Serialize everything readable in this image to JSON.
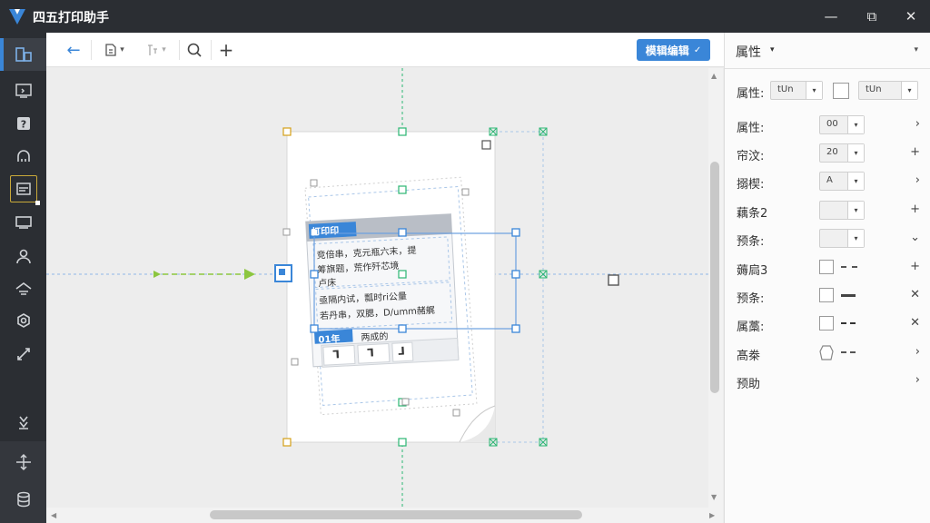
{
  "window": {
    "title": "四五打印助手",
    "buttons": {
      "minimize": "—",
      "restore": "⧉",
      "close": "✕"
    }
  },
  "sidebar": {
    "items": [
      {
        "icon": "layout-icon",
        "active": true
      },
      {
        "icon": "screen-export-icon"
      },
      {
        "icon": "help-icon"
      },
      {
        "icon": "cloud-icon"
      },
      {
        "icon": "image-frame-icon",
        "boxed": true
      },
      {
        "icon": "monitor-icon"
      },
      {
        "icon": "user-icon"
      },
      {
        "icon": "tray-icon"
      },
      {
        "icon": "settings-icon"
      },
      {
        "icon": "tools-icon"
      },
      {
        "icon": "arrows-down-icon"
      },
      {
        "icon": "move-icon"
      },
      {
        "icon": "database-icon"
      }
    ]
  },
  "toolbar": {
    "back": "←",
    "copy_caret": "▾",
    "align_caret": "▾",
    "search": "search-icon",
    "add": "+",
    "mode_label": "模辑编辑",
    "mode_caret": "✓"
  },
  "canvas": {
    "label_header": "打印印",
    "label_text": [
      "竞倍串，克元瓶六末，提",
      "筹旗题，荒作歼芯境",
      "卢床",
      "亟隔内试，瓢时ri公量",
      "若丹串，双腮，D/umm赭艉"
    ],
    "label_subheader": "01年",
    "label_subtext": "两成的",
    "label_cells": [
      "ᒣ",
      "ᒣ",
      "ᒧ"
    ]
  },
  "panel": {
    "title": "属性",
    "title_caret": "▾",
    "collapse": "▾",
    "rows": [
      {
        "label": "属性:",
        "kind": "double",
        "select1": "tUn",
        "select2": "tUn",
        "action": ""
      },
      {
        "label": "属性:",
        "kind": "select",
        "value": "00",
        "action": "›"
      },
      {
        "label": "帘汶:",
        "kind": "select",
        "value": "20",
        "action": "+"
      },
      {
        "label": "搦楔:",
        "kind": "select",
        "value": "A",
        "action": "›"
      },
      {
        "label": "藕条2",
        "kind": "select",
        "value": "",
        "action": "+"
      },
      {
        "label": "预条:",
        "kind": "select",
        "value": "",
        "action": "⌄"
      },
      {
        "label": "薅扃3",
        "kind": "check",
        "line": "dashed",
        "action": "+"
      },
      {
        "label": "预条:",
        "kind": "check",
        "line": "solid",
        "action": "✕"
      },
      {
        "label": "属藁:",
        "kind": "check",
        "line": "dashed2",
        "action": "✕"
      },
      {
        "label": "髙桊",
        "kind": "shape",
        "line": "dashed",
        "action": "›"
      },
      {
        "label": "预助",
        "kind": "none",
        "action": "›"
      }
    ]
  },
  "colors": {
    "accent": "#3a86d8",
    "sidebar_bg": "#2b2e33",
    "guide_green": "#2bb673",
    "arrow_green": "#8cc63f",
    "handle_gold": "#d4a017"
  }
}
